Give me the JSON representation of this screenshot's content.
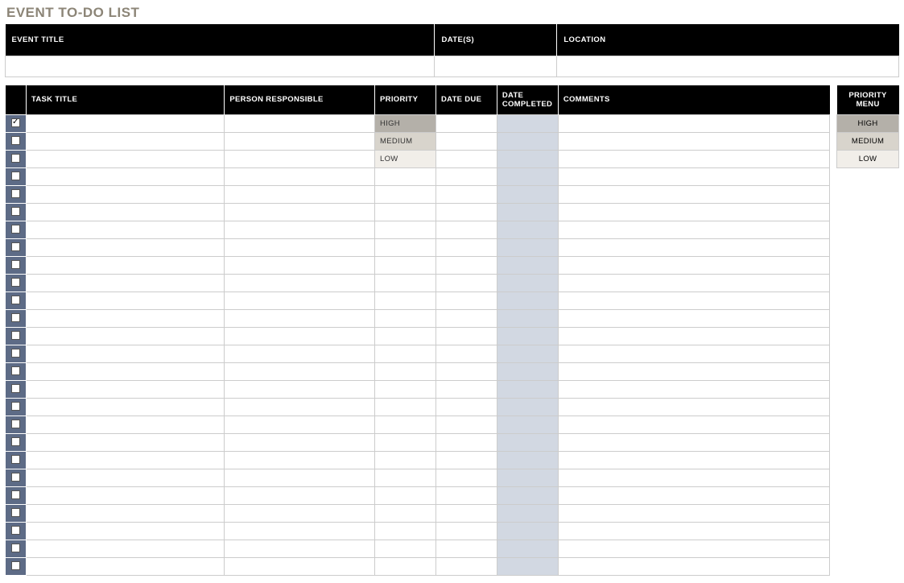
{
  "title": "EVENT TO-DO LIST",
  "event_info": {
    "headers": {
      "event_title": "EVENT TITLE",
      "dates": "DATE(S)",
      "location": "LOCATION"
    },
    "values": {
      "event_title": "",
      "dates": "",
      "location": ""
    }
  },
  "task_headers": {
    "task_title": "TASK TITLE",
    "person": "PERSON RESPONSIBLE",
    "priority": "PRIORITY",
    "due": "DATE DUE",
    "completed": "DATE COMPLETED",
    "comments": "COMMENTS"
  },
  "task_rows": [
    {
      "checked": true,
      "title": "",
      "person": "",
      "priority": "HIGH",
      "due": "",
      "completed": "",
      "comments": ""
    },
    {
      "checked": false,
      "title": "",
      "person": "",
      "priority": "MEDIUM",
      "due": "",
      "completed": "",
      "comments": ""
    },
    {
      "checked": false,
      "title": "",
      "person": "",
      "priority": "LOW",
      "due": "",
      "completed": "",
      "comments": ""
    },
    {
      "checked": false,
      "title": "",
      "person": "",
      "priority": "",
      "due": "",
      "completed": "",
      "comments": ""
    },
    {
      "checked": false,
      "title": "",
      "person": "",
      "priority": "",
      "due": "",
      "completed": "",
      "comments": ""
    },
    {
      "checked": false,
      "title": "",
      "person": "",
      "priority": "",
      "due": "",
      "completed": "",
      "comments": ""
    },
    {
      "checked": false,
      "title": "",
      "person": "",
      "priority": "",
      "due": "",
      "completed": "",
      "comments": ""
    },
    {
      "checked": false,
      "title": "",
      "person": "",
      "priority": "",
      "due": "",
      "completed": "",
      "comments": ""
    },
    {
      "checked": false,
      "title": "",
      "person": "",
      "priority": "",
      "due": "",
      "completed": "",
      "comments": ""
    },
    {
      "checked": false,
      "title": "",
      "person": "",
      "priority": "",
      "due": "",
      "completed": "",
      "comments": ""
    },
    {
      "checked": false,
      "title": "",
      "person": "",
      "priority": "",
      "due": "",
      "completed": "",
      "comments": ""
    },
    {
      "checked": false,
      "title": "",
      "person": "",
      "priority": "",
      "due": "",
      "completed": "",
      "comments": ""
    },
    {
      "checked": false,
      "title": "",
      "person": "",
      "priority": "",
      "due": "",
      "completed": "",
      "comments": ""
    },
    {
      "checked": false,
      "title": "",
      "person": "",
      "priority": "",
      "due": "",
      "completed": "",
      "comments": ""
    },
    {
      "checked": false,
      "title": "",
      "person": "",
      "priority": "",
      "due": "",
      "completed": "",
      "comments": ""
    },
    {
      "checked": false,
      "title": "",
      "person": "",
      "priority": "",
      "due": "",
      "completed": "",
      "comments": ""
    },
    {
      "checked": false,
      "title": "",
      "person": "",
      "priority": "",
      "due": "",
      "completed": "",
      "comments": ""
    },
    {
      "checked": false,
      "title": "",
      "person": "",
      "priority": "",
      "due": "",
      "completed": "",
      "comments": ""
    },
    {
      "checked": false,
      "title": "",
      "person": "",
      "priority": "",
      "due": "",
      "completed": "",
      "comments": ""
    },
    {
      "checked": false,
      "title": "",
      "person": "",
      "priority": "",
      "due": "",
      "completed": "",
      "comments": ""
    },
    {
      "checked": false,
      "title": "",
      "person": "",
      "priority": "",
      "due": "",
      "completed": "",
      "comments": ""
    },
    {
      "checked": false,
      "title": "",
      "person": "",
      "priority": "",
      "due": "",
      "completed": "",
      "comments": ""
    },
    {
      "checked": false,
      "title": "",
      "person": "",
      "priority": "",
      "due": "",
      "completed": "",
      "comments": ""
    },
    {
      "checked": false,
      "title": "",
      "person": "",
      "priority": "",
      "due": "",
      "completed": "",
      "comments": ""
    },
    {
      "checked": false,
      "title": "",
      "person": "",
      "priority": "",
      "due": "",
      "completed": "",
      "comments": ""
    },
    {
      "checked": false,
      "title": "",
      "person": "",
      "priority": "",
      "due": "",
      "completed": "",
      "comments": ""
    }
  ],
  "priority_menu": {
    "header": "PRIORITY MENU",
    "items": [
      {
        "label": "HIGH",
        "class": "pri-high"
      },
      {
        "label": "MEDIUM",
        "class": "pri-medium"
      },
      {
        "label": "LOW",
        "class": "pri-low"
      }
    ]
  },
  "priority_classes": {
    "HIGH": "pri-high",
    "MEDIUM": "pri-medium",
    "LOW": "pri-low"
  }
}
